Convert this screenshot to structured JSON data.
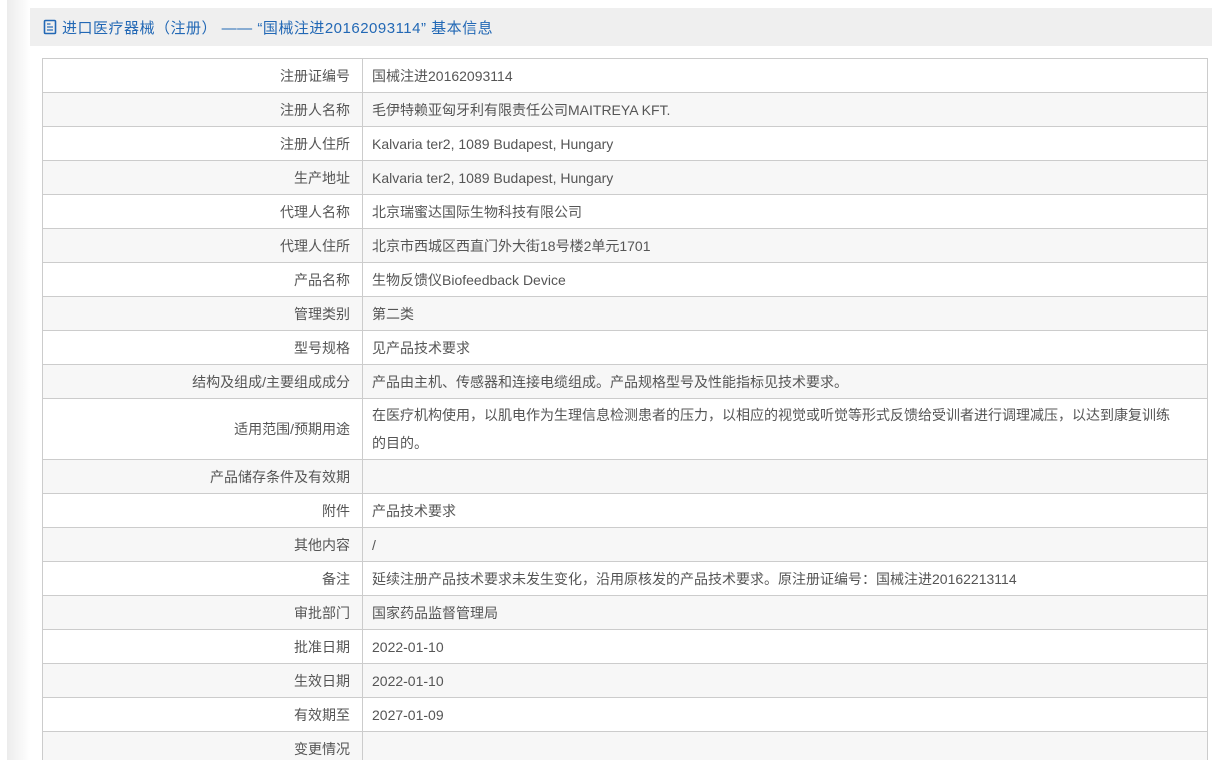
{
  "colors": {
    "accent_blue": "#2268b5",
    "header_bg": "#efefef",
    "row_alt_bg": "#f7f7f7",
    "border": "#cccccc",
    "text": "#555555"
  },
  "header": {
    "title": "进口医疗器械（注册） —— “国械注进20162093114” 基本信息",
    "icon": "document-icon"
  },
  "table": {
    "rows": [
      {
        "label": "注册证编号",
        "value": "国械注进20162093114"
      },
      {
        "label": "注册人名称",
        "value": "毛伊特赖亚匈牙利有限责任公司MAITREYA KFT."
      },
      {
        "label": "注册人住所",
        "value": "Kalvaria ter2, 1089 Budapest, Hungary"
      },
      {
        "label": "生产地址",
        "value": "Kalvaria ter2, 1089 Budapest, Hungary"
      },
      {
        "label": "代理人名称",
        "value": "北京瑞蜜达国际生物科技有限公司"
      },
      {
        "label": "代理人住所",
        "value": "北京市西城区西直门外大街18号楼2单元1701"
      },
      {
        "label": "产品名称",
        "value": "生物反馈仪Biofeedback Device"
      },
      {
        "label": "管理类别",
        "value": "第二类"
      },
      {
        "label": "型号规格",
        "value": "见产品技术要求"
      },
      {
        "label": "结构及组成/主要组成成分",
        "value": "产品由主机、传感器和连接电缆组成。产品规格型号及性能指标见技术要求。"
      },
      {
        "label": "适用范围/预期用途",
        "value": "在医疗机构使用，以肌电作为生理信息检测患者的压力，以相应的视觉或听觉等形式反馈给受训者进行调理减压，以达到康复训练的目的。"
      },
      {
        "label": "产品储存条件及有效期",
        "value": ""
      },
      {
        "label": "附件",
        "value": "产品技术要求"
      },
      {
        "label": "其他内容",
        "value": "/"
      },
      {
        "label": "备注",
        "value": "延续注册产品技术要求未发生变化，沿用原核发的产品技术要求。原注册证编号：国械注进20162213114"
      },
      {
        "label": "审批部门",
        "value": "国家药品监督管理局"
      },
      {
        "label": "批准日期",
        "value": "2022-01-10"
      },
      {
        "label": "生效日期",
        "value": "2022-01-10"
      },
      {
        "label": "有效期至",
        "value": "2027-01-09"
      },
      {
        "label": "变更情况",
        "value": ""
      }
    ]
  }
}
